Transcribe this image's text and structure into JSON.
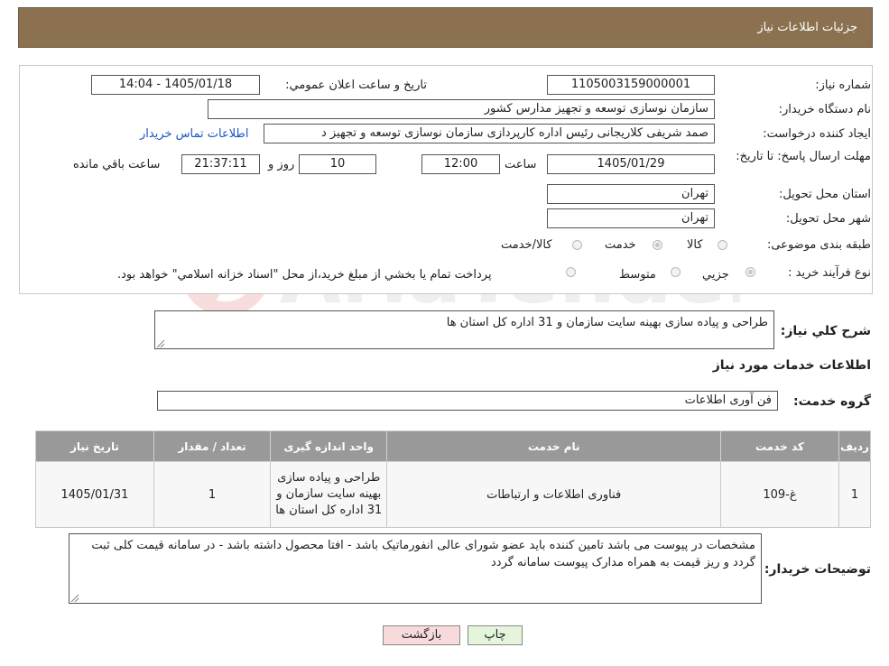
{
  "header": {
    "title": "جزئيات اطلاعات نياز"
  },
  "form": {
    "need_number_label": "شماره نياز:",
    "need_number": "1105003159000001",
    "announce_label": "تاريخ و ساعت اعلان عمومي:",
    "announce_value": "1405/01/18 - 14:04",
    "buyer_org_label": "نام دستگاه خريدار:",
    "buyer_org": "سازمان نوسازی  توسعه و تجهیز مدارس کشور",
    "creator_label": "ايجاد کننده درخواست:",
    "creator": "صمد شریفی کلاریجانی رئیس اداره کارپردازی سازمان نوسازی  توسعه و تجهیز د",
    "contact_link": "اطلاعات تماس خريدار",
    "deadline_label": "مهلت ارسال پاسخ: تا تاريخ:",
    "deadline_date": "1405/01/29",
    "time_label": "ساعت",
    "deadline_time": "12:00",
    "days_value": "10",
    "days_label": "روز و",
    "remaining_time": "21:37:11",
    "remaining_label": "ساعت باقي مانده",
    "province_label": "استان محل تحويل:",
    "province": "تهران",
    "city_label": "شهر محل تحويل:",
    "city": "تهران",
    "category_label": "طبقه بندی موضوعی:",
    "cat_goods": "کالا",
    "cat_service": "خدمت",
    "cat_both": "کالا/خدمت",
    "process_label": "نوع فرآيند خريد :",
    "proc_partial": "جزيي",
    "proc_medium": "متوسط",
    "proc_note": "پرداخت تمام يا بخشي از مبلغ خريد،از محل \"اسناد خزانه اسلامي\" خواهد بود."
  },
  "summary": {
    "label": "شرح کلي نياز:",
    "value": "طراحی و پیاده سازی بهینه سایت سازمان و 31 اداره کل استان ها"
  },
  "services": {
    "heading": "اطلاعات خدمات مورد نياز",
    "group_label": "گروه خدمت:",
    "group_value": "فن آوری اطلاعات",
    "columns": [
      "رديف",
      "کد خدمت",
      "نام خدمت",
      "واحد اندازه گيری",
      "تعداد / مقدار",
      "تاريخ نياز"
    ],
    "rows": [
      {
        "index": "1",
        "code": "غ-109",
        "name": "فناوری اطلاعات و ارتباطات",
        "unit": "طراحی و پیاده سازی بهینه سایت سازمان و 31 اداره کل استان ها",
        "qty": "1",
        "date": "1405/01/31"
      }
    ]
  },
  "notes": {
    "label": "توضيحات خريدار:",
    "value": "مشخصات در پیوست می باشد تامین کننده باید عضو شورای عالی انفورماتیک باشد - افتا محصول داشته باشد - در سامانه قیمت کلی ثبت گردد و ریز قیمت به همراه مدارک پیوست سامانه گردد"
  },
  "buttons": {
    "print": "چاپ",
    "back": "بازگشت"
  },
  "colors": {
    "header_bg": "#8b7150",
    "table_header": "#999999",
    "back_button": "#f8d9dc",
    "print_button": "#e4f5dc"
  }
}
